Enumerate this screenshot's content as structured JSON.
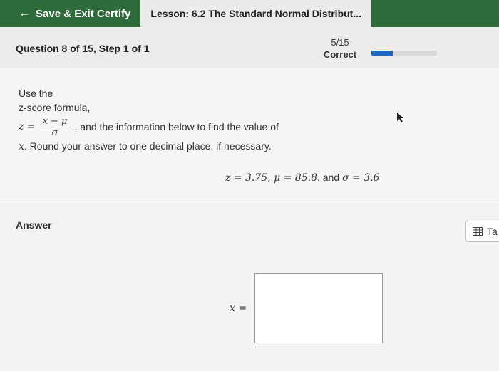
{
  "topbar": {
    "save_exit_label": "Save & Exit Certify",
    "lesson_label": "Lesson: 6.2 The Standard Normal Distribut..."
  },
  "header": {
    "question_step": "Question 8 of 15, Step 1 of 1",
    "score": "5/15",
    "status": "Correct",
    "progress_fraction": 0.33
  },
  "question": {
    "line1": "Use the",
    "line2": "z-score formula,",
    "formula_lhs": "z =",
    "formula_num": "x − μ",
    "formula_den": "σ",
    "line3_tail": ", and the information below to find the value of",
    "line4_var": "x",
    "line4_text": ". Round your answer to one decimal place, if necessary.",
    "given_z": "z = 3.75, μ = 85.8",
    "given_and": ", and ",
    "given_sigma": "σ = 3.6"
  },
  "answer": {
    "label": "Answer",
    "table_button": "Ta",
    "x_label": "x =",
    "value": ""
  },
  "colors": {
    "topbar": "#2f6b3a",
    "progress": "#1f66c9"
  }
}
